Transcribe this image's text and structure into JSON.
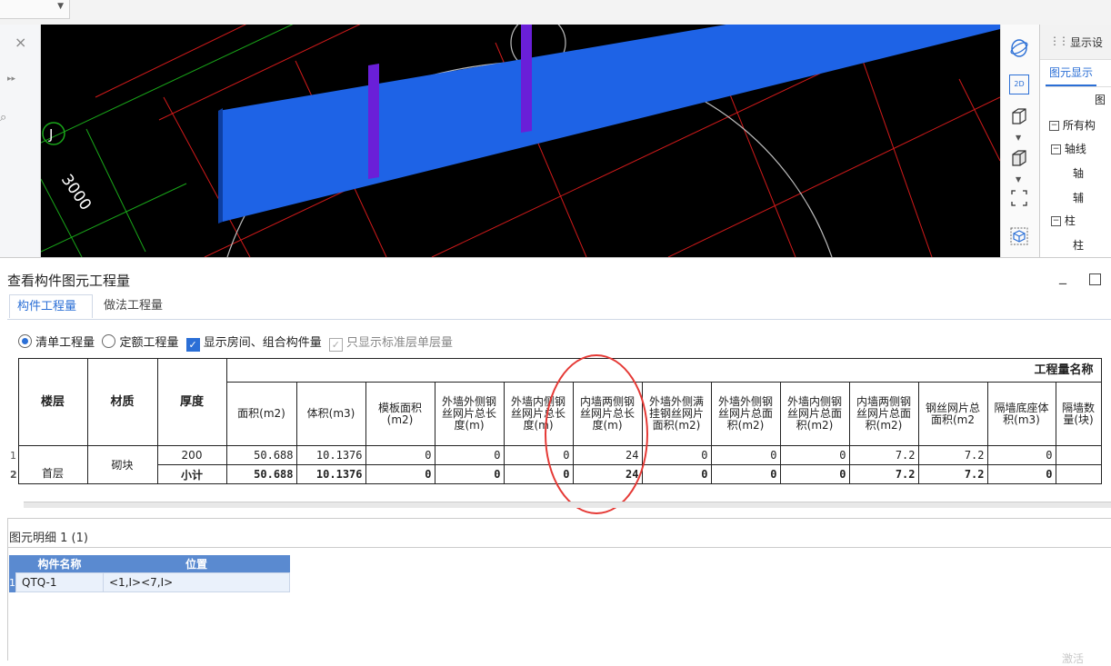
{
  "viewport": {
    "axis_label": "J",
    "dimension": "3000"
  },
  "right_panel": {
    "title": "显示设",
    "tab": "图元显示",
    "col_header": "图",
    "tree": [
      {
        "toggle": "−",
        "label": "所有构"
      },
      {
        "toggle": "−",
        "label": "轴线"
      },
      {
        "toggle": "",
        "label": "轴"
      },
      {
        "toggle": "",
        "label": "辅"
      },
      {
        "toggle": "−",
        "label": "柱"
      },
      {
        "toggle": "",
        "label": "柱"
      }
    ]
  },
  "right_tools": {
    "view_2d": "2D"
  },
  "dialog": {
    "title": "查看构件图元工程量",
    "tabs": [
      "构件工程量",
      "做法工程量"
    ],
    "options": {
      "radio1": "清单工程量",
      "radio2": "定额工程量",
      "check1": "显示房间、组合构件量",
      "check2": "只显示标准层单层量"
    },
    "table": {
      "group_header": "工程量名称",
      "columns": [
        "楼层",
        "材质",
        "厚度",
        "面积(m2)",
        "体积(m3)",
        "模板面积(m2)",
        "外墙外侧钢丝网片总长度(m)",
        "外墙内侧钢丝网片总长度(m)",
        "内墙两侧钢丝网片总长度(m)",
        "外墙外侧满挂钢丝网片面积(m2)",
        "外墙外侧钢丝网片总面积(m2)",
        "外墙内侧钢丝网片总面积(m2)",
        "内墙两侧钢丝网片总面积(m2)",
        "钢丝网片总面积(m2",
        "隔墙底座体积(m3)",
        "隔墙数量(块)"
      ],
      "floor": "首层",
      "material": "砌块",
      "rows": [
        {
          "num": "1",
          "thickness": "200",
          "values": [
            "50.688",
            "10.1376",
            "0",
            "0",
            "0",
            "24",
            "0",
            "0",
            "0",
            "7.2",
            "7.2",
            "0",
            ""
          ]
        },
        {
          "num": "2",
          "thickness": "小计",
          "values": [
            "50.688",
            "10.1376",
            "0",
            "0",
            "0",
            "24",
            "0",
            "0",
            "0",
            "7.2",
            "7.2",
            "0",
            ""
          ]
        }
      ]
    },
    "detail": {
      "title": "图元明细",
      "count": "1 (1)",
      "columns": [
        "构件名称",
        "位置"
      ],
      "rows": [
        {
          "num": "1",
          "name": "QTQ-1",
          "position": "<1,I><7,I>"
        }
      ]
    },
    "footnote": "激活"
  },
  "colors": {
    "accent": "#2b6fd6",
    "wall": "#1e63e6",
    "grid_red": "#d11a1a",
    "grid_green": "#19a619",
    "highlight_circle": "#e53935"
  }
}
